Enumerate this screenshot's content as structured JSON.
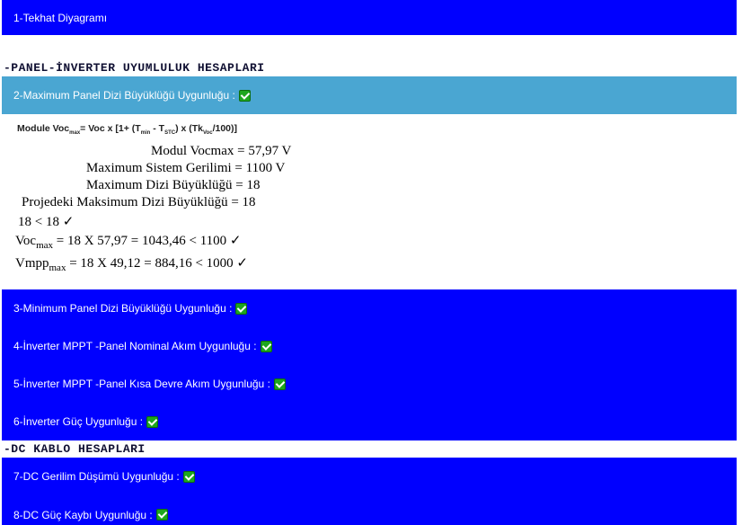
{
  "bars": {
    "b1": "1-Tekhat Diyagramı",
    "b2": "2-Maximum Panel Dizi Büyüklüğü Uygunluğu  :",
    "b3": "3-Minimum  Panel Dizi Büyüklüğü Uygunluğu  :",
    "b4": "4-İnverter MPPT -Panel  Nominal Akım Uygunluğu :",
    "b5": "5-İnverter MPPT -Panel  Kısa Devre  Akım Uygunluğu :",
    "b6": "6-İnverter  Güç Uygunluğu :",
    "b7": "7-DC Gerilim Düşümü Uygunluğu :",
    "b8": "8-DC Güç Kaybı Uygunluğu :"
  },
  "sections": {
    "panel_inverter": "-PANEL-İNVERTER UYUMLULUK HESAPLARI",
    "dc_cable": "-DC KABLO HESAPLARI"
  },
  "formula": {
    "a": "Module Voc",
    "a_sub": "max",
    "b": "= Voc x [1+ (T",
    "b_sub": "min",
    "c": " - T",
    "c_sub": "STC",
    "d": ") x (Tk",
    "d_sub": "Voc",
    "e": "/100)]"
  },
  "calc": {
    "modul_vocmax": "Modul Vocmax = 57,97  V",
    "max_sistem": "Maximum Sistem Gerilimi = 1100 V",
    "max_dizi": "Maximum Dizi Büyüklüğü = 18",
    "proje_dizi": "Projedeki Maksimum Dizi Büyüklüğü =  18",
    "compare1": "18 < 18",
    "voc_label": "Voc",
    "voc_sub": "max",
    "voc_rest": " =   18 X  57,97 = 1043,46 < 1100",
    "vmpp_label": "Vmpp",
    "vmpp_sub": "max",
    "vmpp_rest": " = 18 X 49,12 =  884,16 <  1000",
    "tick": "✓"
  }
}
